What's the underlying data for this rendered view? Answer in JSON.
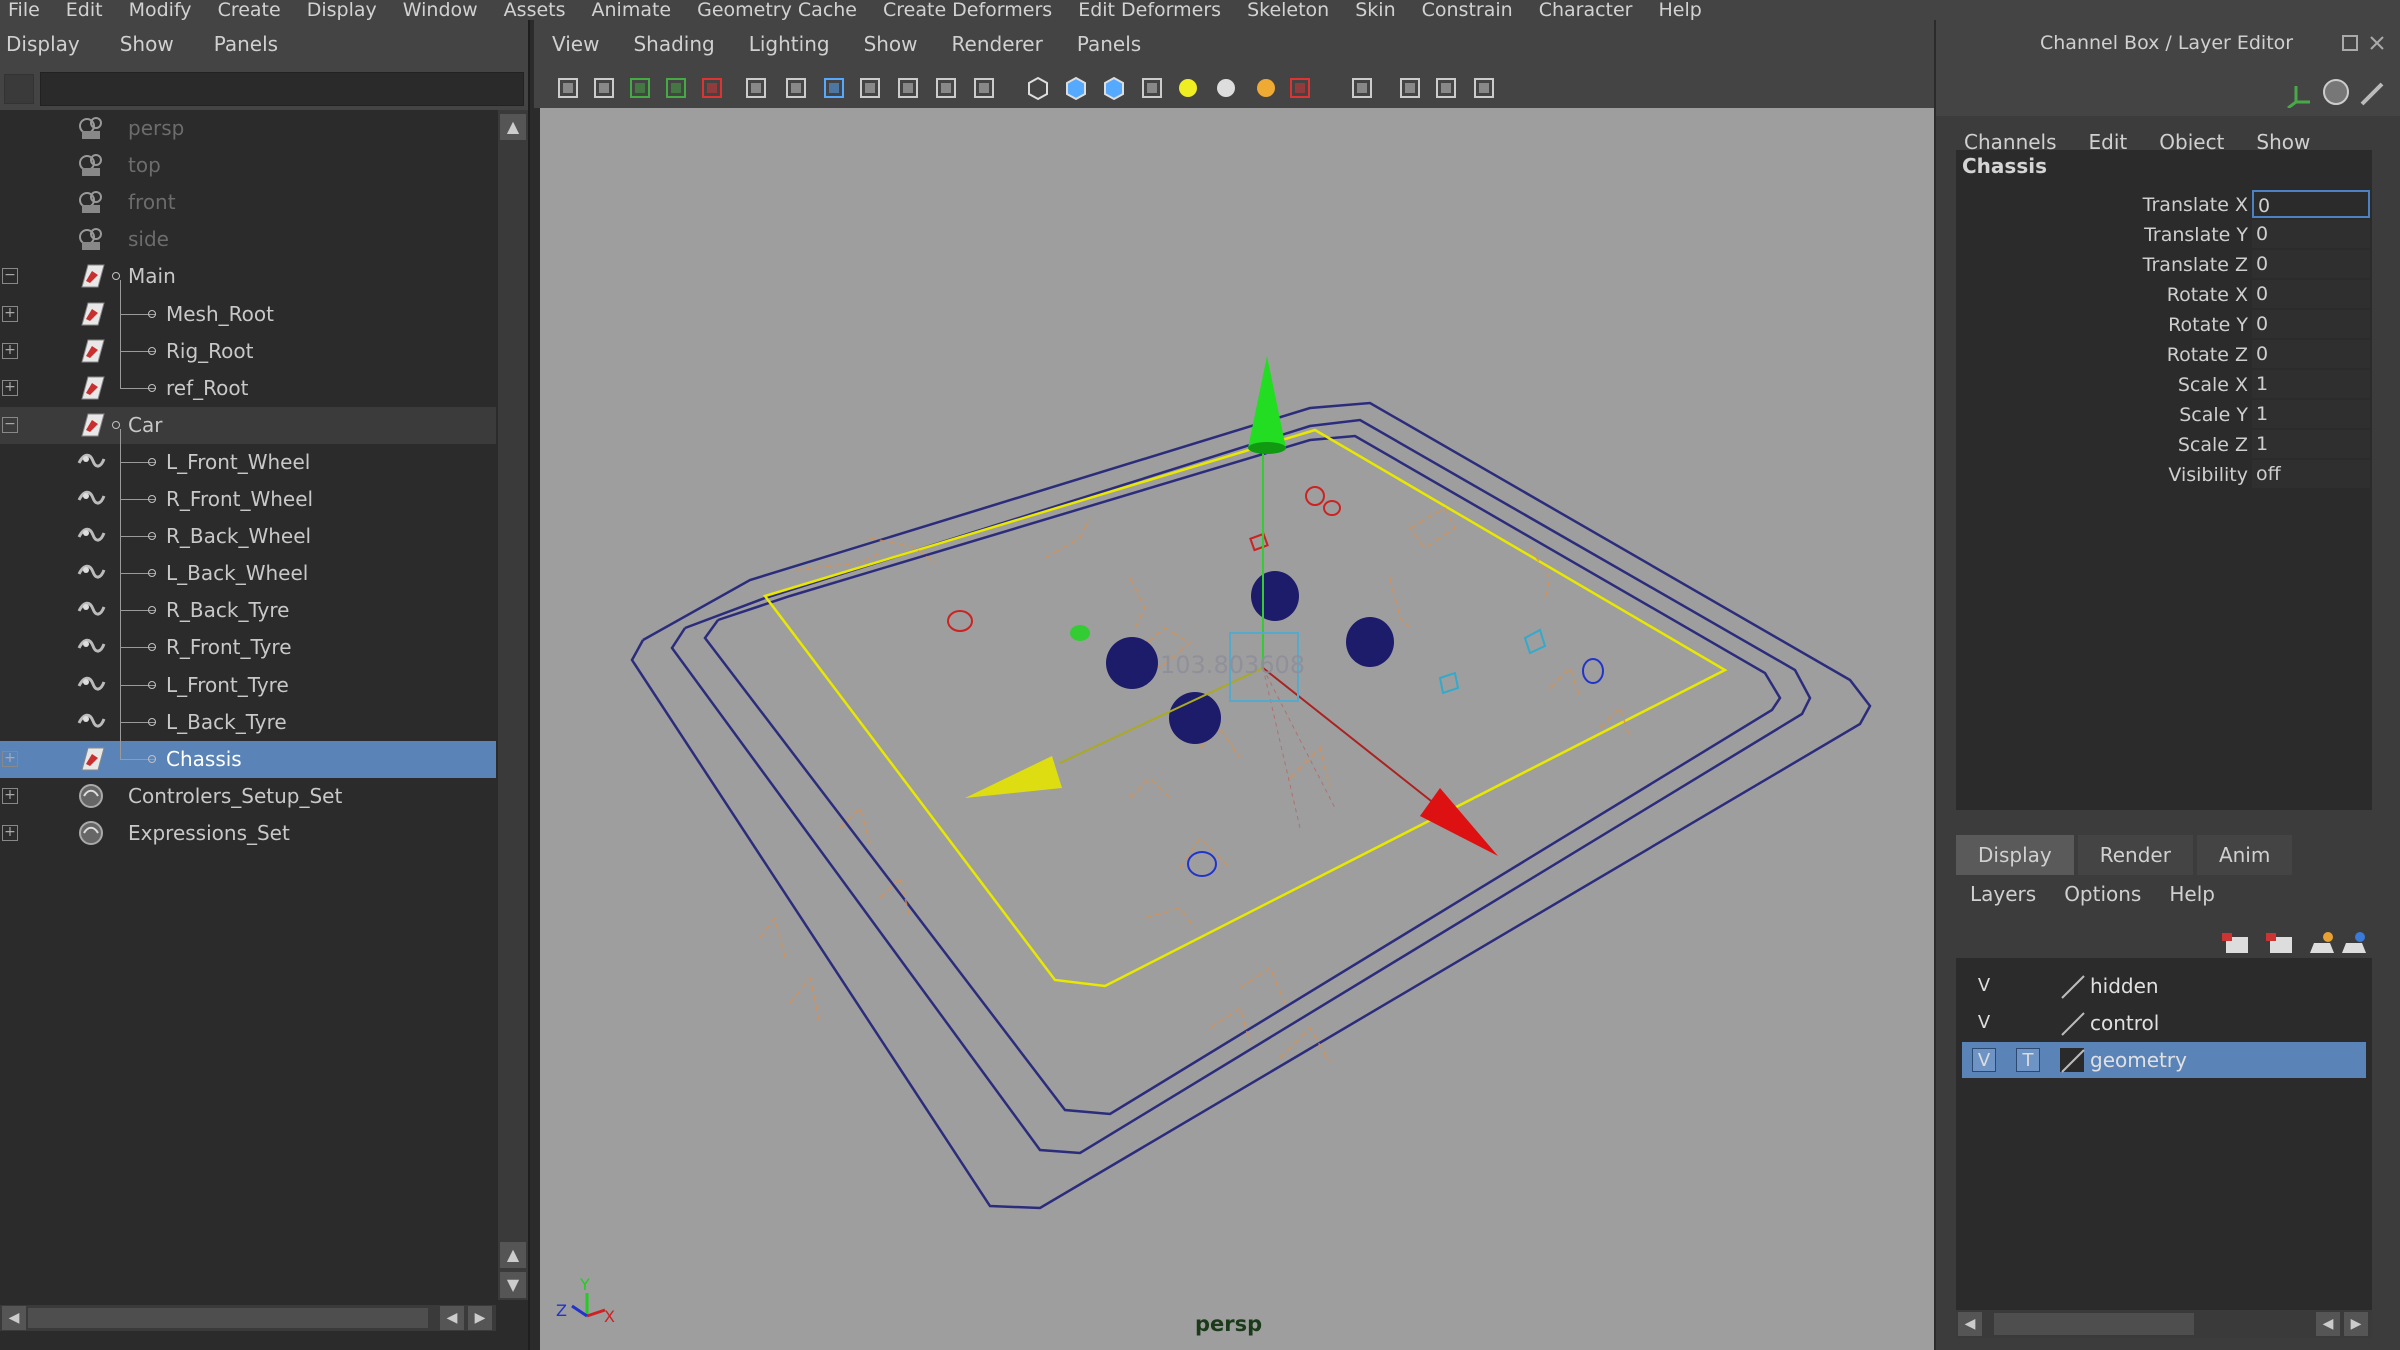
{
  "menubar": [
    "File",
    "Edit",
    "Modify",
    "Create",
    "Display",
    "Window",
    "Assets",
    "Animate",
    "Geometry Cache",
    "Create Deformers",
    "Edit Deformers",
    "Skeleton",
    "Skin",
    "Constrain",
    "Character",
    "Help"
  ],
  "outliner": {
    "menu": [
      "Display",
      "Show",
      "Panels"
    ],
    "items": [
      {
        "label": "persp",
        "icon": "camera-icon",
        "dim": true,
        "expand": ""
      },
      {
        "label": "top",
        "icon": "camera-icon",
        "dim": true,
        "expand": ""
      },
      {
        "label": "front",
        "icon": "camera-icon",
        "dim": true,
        "expand": ""
      },
      {
        "label": "side",
        "icon": "camera-icon",
        "dim": true,
        "expand": ""
      },
      {
        "label": "Main",
        "icon": "transform-icon",
        "expand": "−"
      },
      {
        "label": "Mesh_Root",
        "icon": "transform-icon",
        "expand": "+"
      },
      {
        "label": "Rig_Root",
        "icon": "transform-icon",
        "expand": "+"
      },
      {
        "label": "ref_Root",
        "icon": "transform-icon",
        "expand": "+"
      },
      {
        "label": "Car",
        "icon": "transform-icon",
        "expand": "−"
      },
      {
        "label": "L_Front_Wheel",
        "icon": "curve-icon",
        "expand": ""
      },
      {
        "label": "R_Front_Wheel",
        "icon": "curve-icon",
        "expand": ""
      },
      {
        "label": "R_Back_Wheel",
        "icon": "curve-icon",
        "expand": ""
      },
      {
        "label": "L_Back_Wheel",
        "icon": "curve-icon",
        "expand": ""
      },
      {
        "label": "R_Back_Tyre",
        "icon": "curve-icon",
        "expand": ""
      },
      {
        "label": "R_Front_Tyre",
        "icon": "curve-icon",
        "expand": ""
      },
      {
        "label": "L_Front_Tyre",
        "icon": "curve-icon",
        "expand": ""
      },
      {
        "label": "L_Back_Tyre",
        "icon": "curve-icon",
        "expand": ""
      },
      {
        "label": "Chassis",
        "icon": "transform-icon",
        "expand": "+"
      },
      {
        "label": "Controlers_Setup_Set",
        "icon": "set-icon",
        "expand": "+"
      },
      {
        "label": "Expressions_Set",
        "icon": "set-icon",
        "expand": "+"
      }
    ]
  },
  "viewport": {
    "menu": [
      "View",
      "Shading",
      "Lighting",
      "Show",
      "Renderer",
      "Panels"
    ],
    "camera_label": "persp",
    "hud_value": "103.803608",
    "axis": {
      "x": "X",
      "y": "Y",
      "z": "Z"
    }
  },
  "channel_box": {
    "title": "Channel Box / Layer Editor",
    "menu": [
      "Channels",
      "Edit",
      "Object",
      "Show"
    ],
    "object": "Chassis",
    "channels": [
      {
        "name": "Translate X",
        "value": "0"
      },
      {
        "name": "Translate Y",
        "value": "0"
      },
      {
        "name": "Translate Z",
        "value": "0"
      },
      {
        "name": "Rotate X",
        "value": "0"
      },
      {
        "name": "Rotate Y",
        "value": "0"
      },
      {
        "name": "Rotate Z",
        "value": "0"
      },
      {
        "name": "Scale X",
        "value": "1"
      },
      {
        "name": "Scale Y",
        "value": "1"
      },
      {
        "name": "Scale Z",
        "value": "1"
      },
      {
        "name": "Visibility",
        "value": "off"
      }
    ]
  },
  "layer_editor": {
    "tabs": [
      "Display",
      "Render",
      "Anim"
    ],
    "menu": [
      "Layers",
      "Options",
      "Help"
    ],
    "layers": [
      {
        "v": "V",
        "t": "",
        "name": "hidden"
      },
      {
        "v": "V",
        "t": "",
        "name": "control"
      },
      {
        "v": "V",
        "t": "T",
        "name": "geometry"
      }
    ]
  },
  "colors": {
    "selection": "#5a84b8",
    "viewport_bg": "#9e9e9e",
    "manip_x": "#cc1111",
    "manip_y": "#11cc11",
    "manip_z": "#cccc11"
  }
}
